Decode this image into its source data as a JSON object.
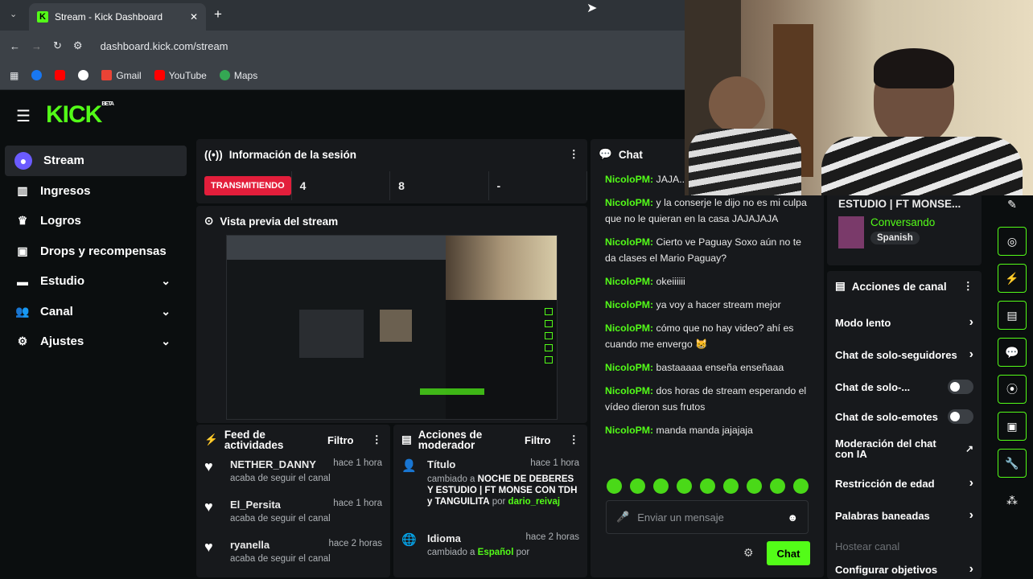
{
  "browser": {
    "tab_title": "Stream - Kick Dashboard",
    "url": "dashboard.kick.com/stream",
    "bookmarks": [
      "Gmail",
      "YouTube",
      "Maps"
    ]
  },
  "logo": {
    "text": "KICK",
    "beta": "BETA"
  },
  "sidebar": {
    "items": [
      {
        "label": "Stream"
      },
      {
        "label": "Ingresos"
      },
      {
        "label": "Logros"
      },
      {
        "label": "Drops y recompensas"
      },
      {
        "label": "Estudio"
      },
      {
        "label": "Canal"
      },
      {
        "label": "Ajustes"
      }
    ]
  },
  "session": {
    "title": "Información de la sesión",
    "status": "TRANSMITIENDO",
    "stat1": "4",
    "stat2": "8",
    "stat3": "-"
  },
  "preview": {
    "title": "Vista previa del stream"
  },
  "feed": {
    "title": "Feed de actividades",
    "filter": "Filtro",
    "items": [
      {
        "name": "NETHER_DANNY",
        "time": "hace 1 hora",
        "desc": "acaba de seguir el canal"
      },
      {
        "name": "El_Persita",
        "time": "hace 1 hora",
        "desc": "acaba de seguir el canal"
      },
      {
        "name": "ryanella",
        "time": "hace 2 horas",
        "desc": "acaba de seguir el canal"
      }
    ]
  },
  "modactions": {
    "title": "Acciones de moderador",
    "filter": "Filtro",
    "items": [
      {
        "name": "Título",
        "time": "hace 1 hora",
        "desc1": "cambiado a",
        "value": "NOCHE DE DEBERES Y ESTUDIO | FT MONSE CON TDH y TANGUILITA",
        "desc2": "por",
        "user": "dario_reivaj"
      },
      {
        "name": "Idioma",
        "time": "hace 2 horas",
        "desc1": "cambiado a",
        "value": "Español",
        "desc2": "por"
      }
    ]
  },
  "chat": {
    "title": "Chat",
    "messages": [
      {
        "user": "NicoloPM:",
        "text": "JAJA... la conserje"
      },
      {
        "user": "NicoloPM:",
        "text": "y la conserje le dijo no es mi culpa que no le quieran en la casa JAJAJAJA"
      },
      {
        "user": "NicoloPM:",
        "text": "Cierto ve Paguay Soxo aún no te da clases el Mario Paguay?"
      },
      {
        "user": "NicoloPM:",
        "text": "okeiiiiii"
      },
      {
        "user": "NicoloPM:",
        "text": "ya voy a hacer stream mejor"
      },
      {
        "user": "NicoloPM:",
        "text": "cómo que no hay video? ahí es cuando me envergo 😸"
      },
      {
        "user": "NicoloPM:",
        "text": "bastaaaaa enseña enseñaaa"
      },
      {
        "user": "NicoloPM:",
        "text": "dos horas de stream esperando el vídeo dieron sus frutos"
      },
      {
        "user": "NicoloPM:",
        "text": "manda manda jajajaja"
      }
    ],
    "placeholder": "Enviar un mensaje",
    "send": "Chat"
  },
  "streaminfo": {
    "title": "ESTUDIO | FT MONSE...",
    "category": "Conversando",
    "language": "Spanish"
  },
  "chanact": {
    "title": "Acciones de canal",
    "rows": [
      {
        "label": "Modo lento"
      },
      {
        "label": "Chat de solo-seguidores"
      },
      {
        "label": "Chat de solo-..."
      },
      {
        "label": "Chat de solo-emotes"
      },
      {
        "label": "Moderación del chat con IA"
      },
      {
        "label": "Restricción de edad"
      },
      {
        "label": "Palabras baneadas"
      },
      {
        "label": "Hostear canal"
      },
      {
        "label": "Configurar objetivos"
      }
    ]
  },
  "colors": {
    "accent": "#53fc18",
    "live": "#e31e3b"
  }
}
